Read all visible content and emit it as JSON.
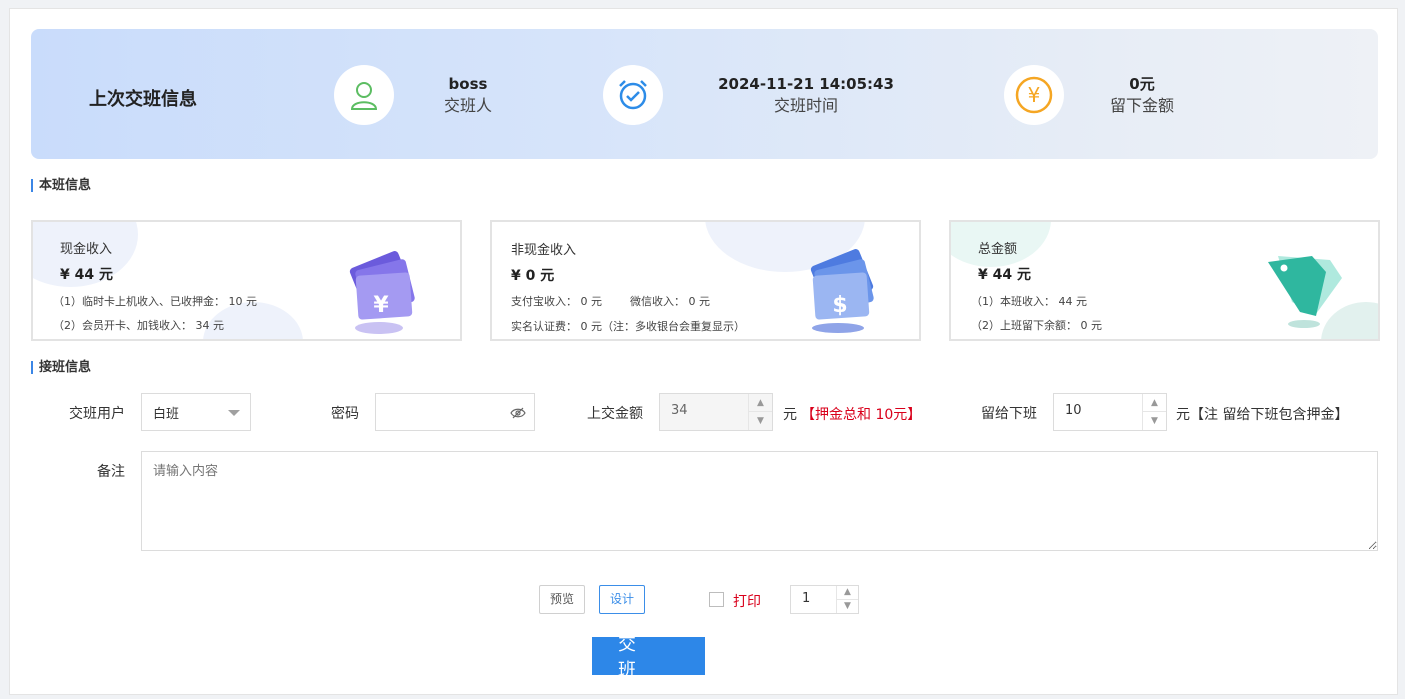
{
  "last_shift": {
    "title": "上次交班信息",
    "handover_user": {
      "value": "boss",
      "label": "交班人"
    },
    "handover_time": {
      "value": "2024-11-21 14:05:43",
      "label": "交班时间"
    },
    "left_amount": {
      "value": "0元",
      "label": "留下金额"
    }
  },
  "current_shift": {
    "title": "本班信息",
    "cash": {
      "title": "现金收入",
      "value": "¥  44  元",
      "line1": "（1）临时卡上机收入、已收押金： 10 元",
      "line2": "（2）会员开卡、加钱收入： 34 元"
    },
    "noncash": {
      "title": "非现金收入",
      "value": "¥ 0 元",
      "line1a": "支付宝收入： 0 元",
      "line1b": "微信收入： 0 元",
      "line2": "实名认证费： 0 元（注：多收银台会重复显示）"
    },
    "total": {
      "title": "总金额",
      "value": "¥  44  元",
      "line1": "（1）本班收入： 44 元",
      "line2": "（2）上班留下余额： 0 元"
    }
  },
  "takeover": {
    "title": "接班信息",
    "user_label": "交班用户",
    "user_value": "白班",
    "password_label": "密码",
    "submit_amount_label": "上交金额",
    "submit_amount_value": "34",
    "submit_amount_unit": "元",
    "submit_amount_note": "【押金总和 10元】",
    "leave_label": "留给下班",
    "leave_value": "10",
    "leave_note": "元【注 留给下班包含押金】",
    "remark_label": "备注",
    "remark_placeholder": "请输入内容"
  },
  "actions": {
    "preview": "预览",
    "design": "设计",
    "print": "打印",
    "print_copies": "1",
    "submit": "交班"
  },
  "colors": {
    "accent": "#2d87e8",
    "warning": "#d9001b"
  }
}
